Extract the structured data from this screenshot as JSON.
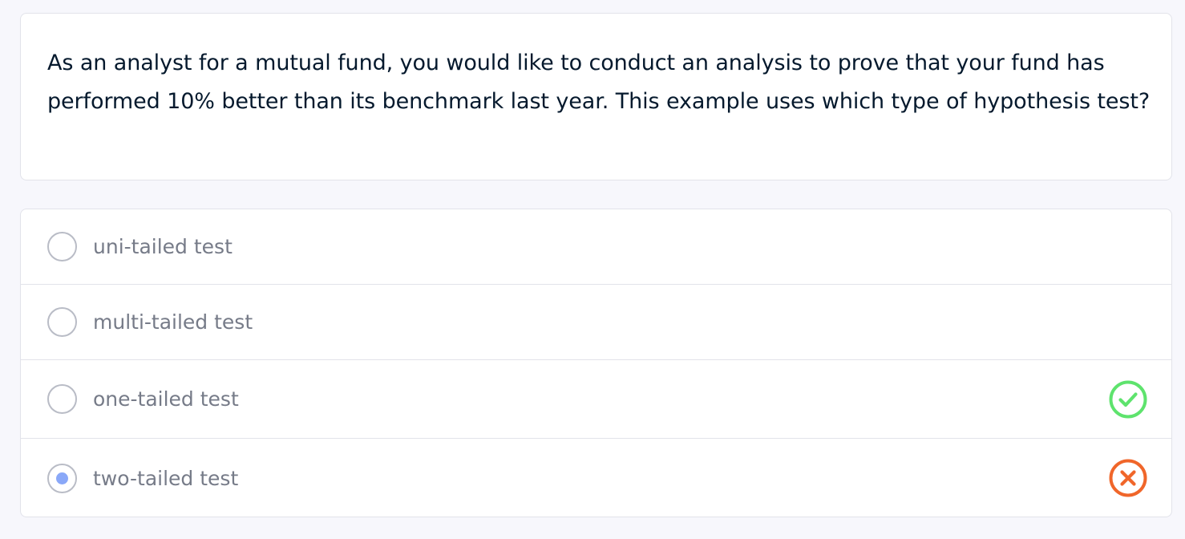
{
  "question": {
    "text": "As an analyst for a mutual fund, you would like to conduct an analysis to prove that your fund has performed 10% better than its benchmark last year. This example uses which type of hypothesis test?"
  },
  "options": [
    {
      "label": "uni-tailed test",
      "selected": false,
      "status": null
    },
    {
      "label": "multi-tailed test",
      "selected": false,
      "status": null
    },
    {
      "label": "one-tailed test",
      "selected": false,
      "status": "correct",
      "status_icon": "check-circle-icon"
    },
    {
      "label": "two-tailed test",
      "selected": true,
      "status": "incorrect",
      "status_icon": "x-circle-icon"
    }
  ],
  "colors": {
    "correct": "#5ee36d",
    "incorrect": "#f0662a",
    "selected_dot": "#8aa8f8"
  }
}
